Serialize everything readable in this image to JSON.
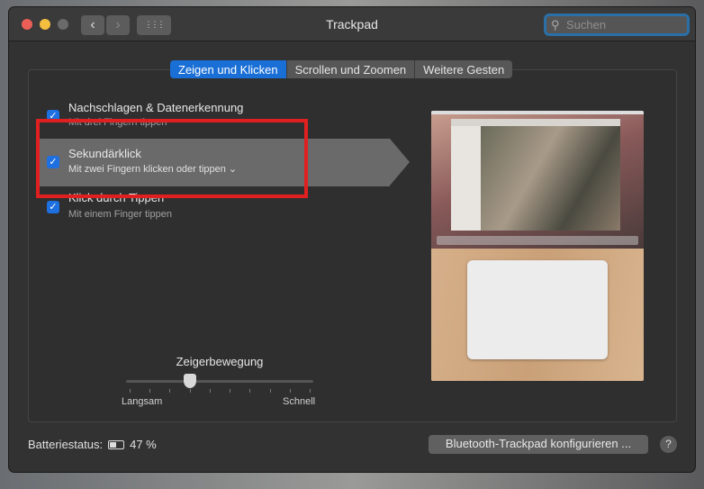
{
  "window": {
    "title": "Trackpad",
    "back_icon": "‹",
    "forward_icon": "›",
    "grid_icon": "⋮⋮⋮"
  },
  "search": {
    "placeholder": "Suchen",
    "icon": "⚲"
  },
  "tabs": [
    {
      "label": "Zeigen und Klicken",
      "active": true
    },
    {
      "label": "Scrollen und Zoomen"
    },
    {
      "label": "Weitere Gesten"
    }
  ],
  "options": [
    {
      "title": "Nachschlagen & Datenerkennung",
      "subtitle": "Mit drei Fingern tippen",
      "checked": true
    },
    {
      "title": "Sekundärklick",
      "subtitle": "Mit zwei Fingern klicken oder tippen ⌄",
      "checked": true
    },
    {
      "title": "Klick durch Tippen",
      "subtitle": "Mit einem Finger tippen",
      "checked": true
    }
  ],
  "check_glyph": "✓",
  "slider": {
    "label": "Zeigerbewegung",
    "min_label": "Langsam",
    "max_label": "Schnell",
    "ticks": 10,
    "value_fraction": 0.333
  },
  "battery": {
    "label": "Batteriestatus:",
    "value": "47 %",
    "level": 0.47
  },
  "configure_button": "Bluetooth-Trackpad konfigurieren ...",
  "help": "?",
  "colors": {
    "accent": "#1a6fd6",
    "highlight_box": "#e02020"
  }
}
